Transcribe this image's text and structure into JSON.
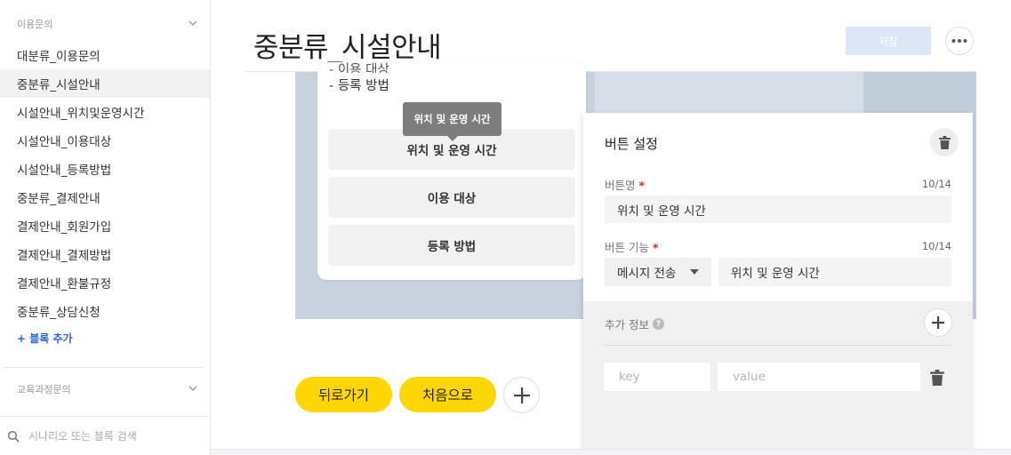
{
  "sidebar": {
    "group1_label": "이용문의",
    "items": [
      {
        "label": "대분류_이용문의"
      },
      {
        "label": "중분류_시설안내"
      },
      {
        "label": "시설안내_위치및운영시간"
      },
      {
        "label": "시설안내_이용대상"
      },
      {
        "label": "시설안내_등록방법"
      },
      {
        "label": "중분류_결제안내"
      },
      {
        "label": "결제안내_회원가입"
      },
      {
        "label": "결제안내_결제방법"
      },
      {
        "label": "결제안내_환불규정"
      },
      {
        "label": "중분류_상담신청"
      }
    ],
    "active_index": 1,
    "add_block_label": "+ 블록 추가",
    "group2_label": "교육과정문의",
    "search_placeholder": "시나리오 또는 블록 검색"
  },
  "header": {
    "title": "중분류_시설안내",
    "save_label": "저장",
    "more_icon": "more-horizontal-icon"
  },
  "bubble": {
    "cut_line": "- 이용 대상",
    "text_line": "- 등록 방법",
    "buttons": [
      {
        "label": "위치 및 운영 시간"
      },
      {
        "label": "이용 대상"
      },
      {
        "label": "등록 방법"
      }
    ],
    "tooltip": "위치 및 운영 시간"
  },
  "panel": {
    "title": "버튼 설정",
    "name_label": "버튼명",
    "name_counter": "10/14",
    "name_value": "위치 및 운영 시간",
    "func_label": "버튼 기능",
    "func_counter": "10/14",
    "func_select": "메시지 전송",
    "func_value": "위치 및 운영 시간",
    "required_mark": "*",
    "extra_label": "추가 정보",
    "help_mark": "?",
    "key_placeholder": "key",
    "value_placeholder": "value"
  },
  "footer": {
    "back_label": "뒤로가기",
    "home_label": "처음으로"
  },
  "colors": {
    "accent_yellow": "#ffd600",
    "link_blue": "#2d66c8",
    "save_disabled": "#dce6f7",
    "canvas": "#c8d2dd"
  }
}
